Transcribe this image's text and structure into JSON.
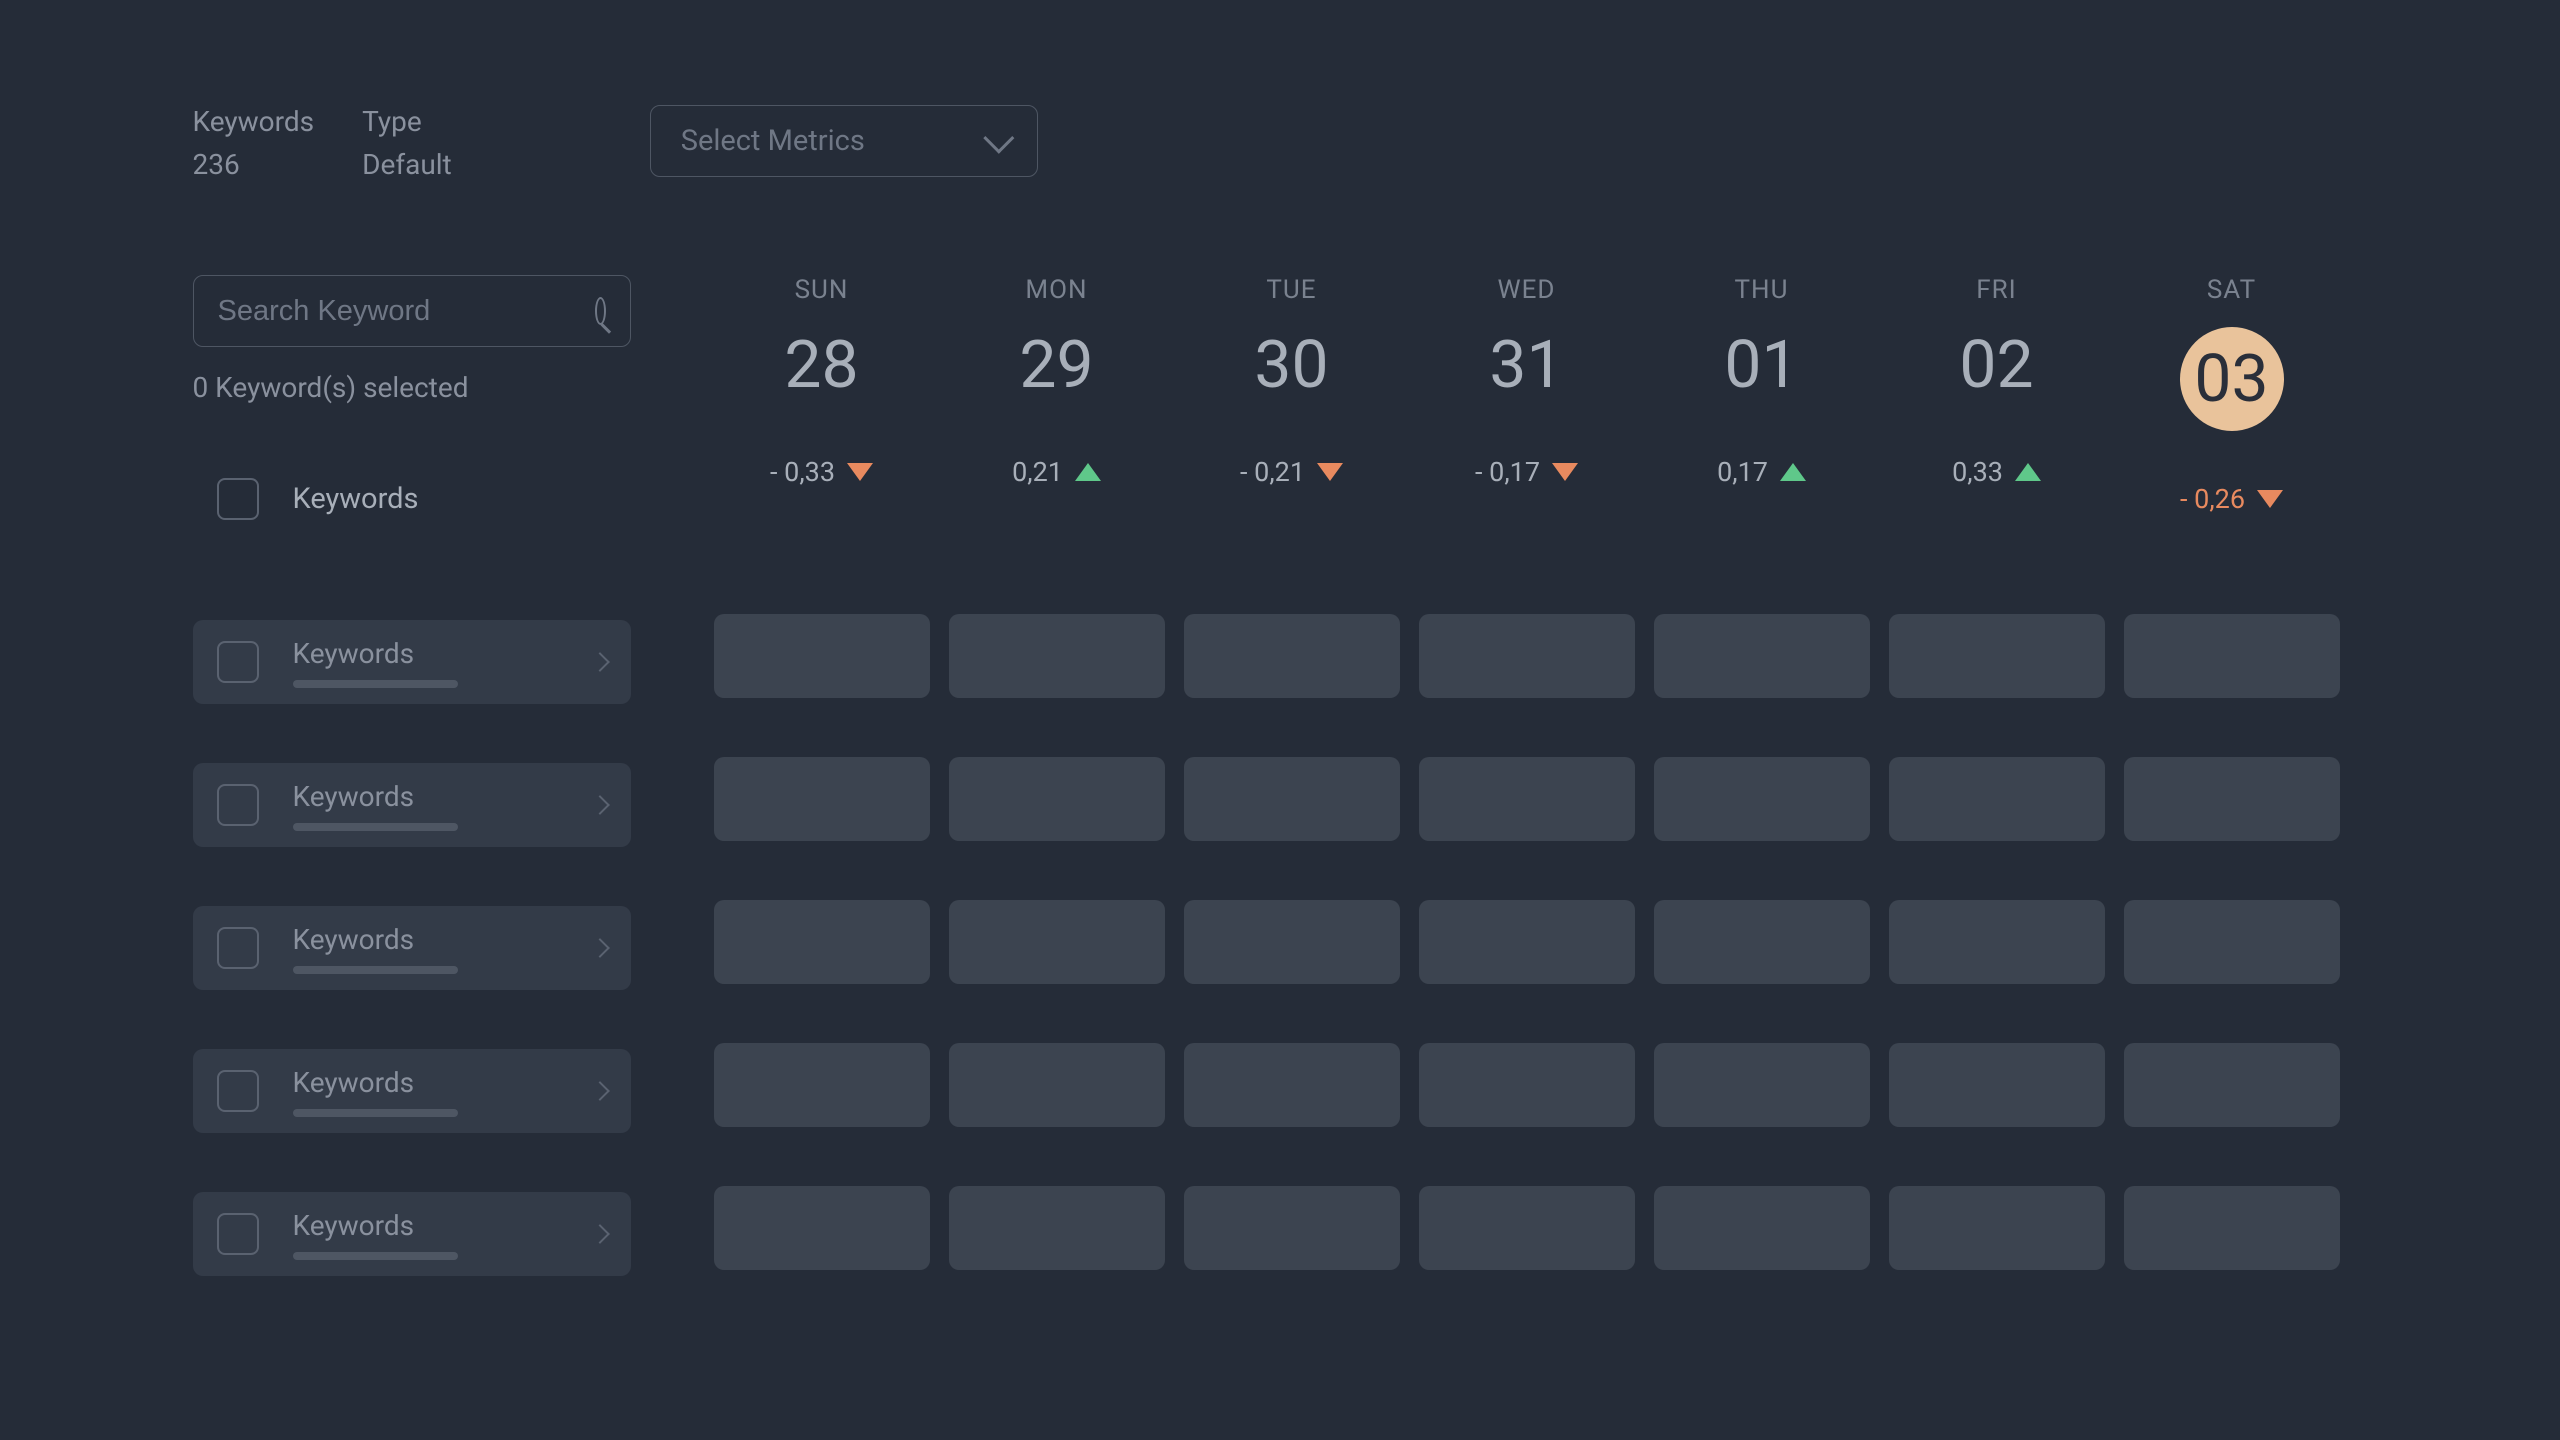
{
  "header": {
    "keywords_label": "Keywords",
    "keywords_value": "236",
    "type_label": "Type",
    "type_value": "Default",
    "metrics_placeholder": "Select Metrics"
  },
  "search": {
    "placeholder": "Search Keyword"
  },
  "selected_text": "0 Keyword(s) selected",
  "list_header": "Keywords",
  "items": [
    {
      "label": "Keywords"
    },
    {
      "label": "Keywords"
    },
    {
      "label": "Keywords"
    },
    {
      "label": "Keywords"
    },
    {
      "label": "Keywords"
    }
  ],
  "days": [
    {
      "name": "SUN",
      "num": "28",
      "metric": "- 0,33",
      "dir": "down",
      "today": false
    },
    {
      "name": "MON",
      "num": "29",
      "metric": "0,21",
      "dir": "up",
      "today": false
    },
    {
      "name": "TUE",
      "num": "30",
      "metric": "- 0,21",
      "dir": "down",
      "today": false
    },
    {
      "name": "WED",
      "num": "31",
      "metric": "- 0,17",
      "dir": "down",
      "today": false
    },
    {
      "name": "THU",
      "num": "01",
      "metric": "0,17",
      "dir": "up",
      "today": false
    },
    {
      "name": "FRI",
      "num": "02",
      "metric": "0,33",
      "dir": "up",
      "today": false
    },
    {
      "name": "SAT",
      "num": "03",
      "metric": "- 0,26",
      "dir": "down",
      "today": true
    }
  ],
  "grid_rows": 5,
  "grid_cols": 7
}
